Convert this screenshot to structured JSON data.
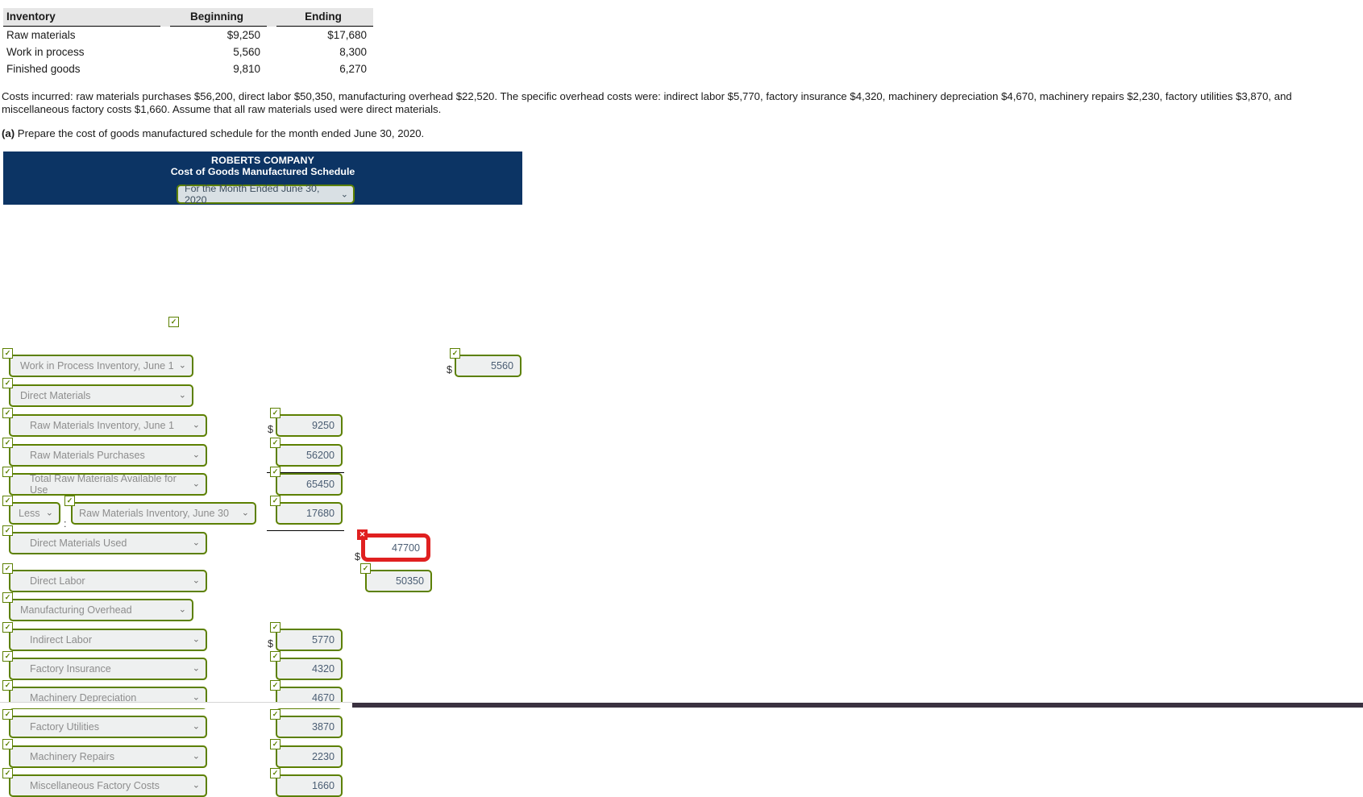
{
  "inventory_table": {
    "headers": [
      "Inventory",
      "Beginning",
      "Ending"
    ],
    "rows": [
      {
        "label": "Raw materials",
        "beginning": "$9,250",
        "ending": "$17,680"
      },
      {
        "label": "Work in process",
        "beginning": "5,560",
        "ending": "8,300"
      },
      {
        "label": "Finished goods",
        "beginning": "9,810",
        "ending": "6,270"
      }
    ]
  },
  "costs_paragraph": "Costs incurred: raw materials purchases $56,200, direct labor $50,350, manufacturing overhead $22,520. The specific overhead costs were: indirect labor $5,770, factory insurance $4,320, machinery depreciation $4,670, machinery repairs $2,230, factory utilities $3,870, and miscellaneous factory costs $1,660. Assume that all raw materials used were direct materials.",
  "question": {
    "part": "(a)",
    "text": "Prepare the cost of goods manufactured schedule for the month ended June 30, 2020."
  },
  "schedule": {
    "company": "ROBERTS COMPANY",
    "title": "Cost of Goods Manufactured Schedule",
    "period": "For the Month Ended June 30, 2020",
    "rows": [
      {
        "label": "Work in Process Inventory, June 1",
        "value": "5560",
        "status": "correct",
        "dollar": true
      },
      {
        "label": "Direct Materials",
        "value": "",
        "status": "correct",
        "dollar": false
      },
      {
        "label": "Raw Materials Inventory, June 1",
        "value": "9250",
        "status": "correct",
        "dollar": true
      },
      {
        "label": "Raw Materials Purchases",
        "value": "56200",
        "status": "correct",
        "dollar": false
      },
      {
        "label": "Total Raw Materials Available for Use",
        "value": "65450",
        "status": "correct",
        "dollar": false
      },
      {
        "label": "Raw Materials Inventory, June 30",
        "prefix": "Less",
        "value": "17680",
        "status": "correct",
        "dollar": false
      },
      {
        "label": "Direct Materials Used",
        "value": "47700",
        "status": "incorrect",
        "dollar": true
      },
      {
        "label": "Direct Labor",
        "value": "50350",
        "status": "correct",
        "dollar": false
      },
      {
        "label": "Manufacturing Overhead",
        "value": "",
        "status": "correct",
        "dollar": false
      },
      {
        "label": "Indirect Labor",
        "value": "5770",
        "status": "correct",
        "dollar": true
      },
      {
        "label": "Factory Insurance",
        "value": "4320",
        "status": "correct",
        "dollar": false
      },
      {
        "label": "Machinery Depreciation",
        "value": "4670",
        "status": "correct",
        "dollar": false
      },
      {
        "label": "Factory Utilities",
        "value": "3870",
        "status": "correct",
        "dollar": false
      },
      {
        "label": "Machinery Repairs",
        "value": "2230",
        "status": "correct",
        "dollar": false
      },
      {
        "label": "Miscellaneous Factory Costs",
        "value": "1660",
        "status": "correct",
        "dollar": false
      }
    ],
    "less_label": "Less",
    "less_colon": ":",
    "dollar_symbol": "$",
    "caret": "⌄",
    "badge_ok": "✓",
    "badge_bad": "✕"
  },
  "colors": {
    "header_blue": "#0c3464",
    "valid_green": "#5c8001",
    "error_red": "#e02020",
    "field_grey": "#eef0f0"
  }
}
